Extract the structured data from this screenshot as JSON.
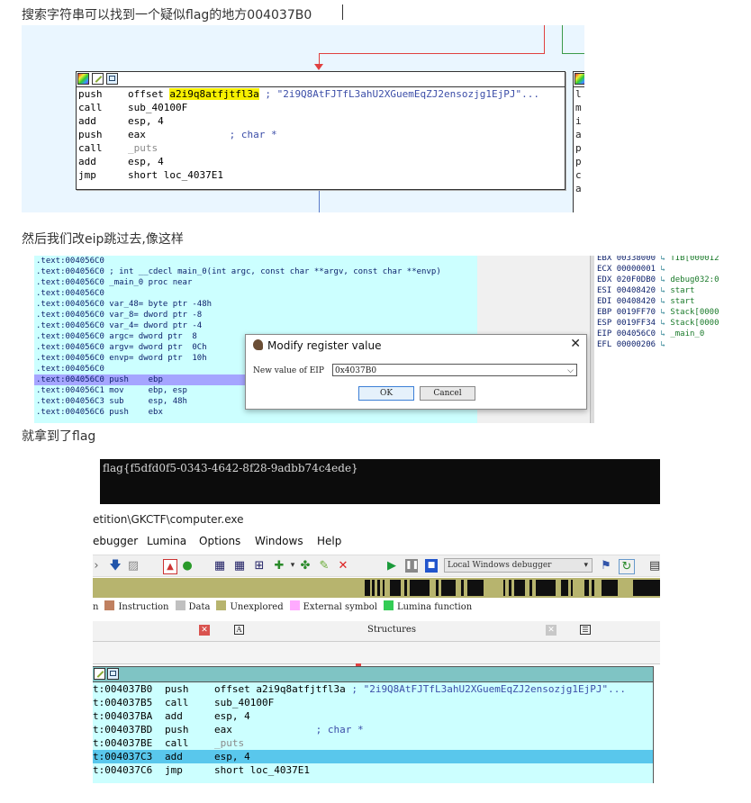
{
  "section1": {
    "heading": "搜索字符串可以找到一个疑似flag的地方004037B0",
    "node_icons": [
      "color-palette-icon",
      "pen-edit-icon",
      "graph-view-icon"
    ],
    "lines": [
      {
        "mnemonic": "push",
        "operand": "offset ",
        "highlight": "a2i9q8atfjtfl3a",
        "comment": " ; \"2i9Q8AtFJTfL3ahU2XGuemEqZJ2ensozjg1EjPJ\"..."
      },
      {
        "mnemonic": "call",
        "operand": "sub_40100F",
        "highlight": "",
        "comment": ""
      },
      {
        "mnemonic": "add",
        "operand": "esp, 4",
        "highlight": "",
        "comment": ""
      },
      {
        "mnemonic": "push",
        "operand": "eax",
        "highlight": "",
        "comment": "              ; char *"
      },
      {
        "mnemonic": "call",
        "operand": "_puts",
        "highlight": "",
        "comment": ""
      },
      {
        "mnemonic": "add",
        "operand": "esp, 4",
        "highlight": "",
        "comment": ""
      },
      {
        "mnemonic": "jmp",
        "operand": "short loc_4037E1",
        "highlight": "",
        "comment": ""
      }
    ],
    "right_node_chars": [
      "l",
      "m",
      "i",
      "a",
      "p",
      "p",
      "c",
      "a"
    ]
  },
  "section2": {
    "heading": "然后我们改eip跳过去,像这样",
    "code_lines": [
      ".text:004056C0",
      ".text:004056C0 ; int __cdecl main_0(int argc, const char **argv, const char **envp)",
      ".text:004056C0 _main_0 proc near",
      ".text:004056C0",
      ".text:004056C0 var_48= byte ptr -48h",
      ".text:004056C0 var_8= dword ptr -8",
      ".text:004056C0 var_4= dword ptr -4",
      ".text:004056C0 argc= dword ptr  8",
      ".text:004056C0 argv= dword ptr  0Ch",
      ".text:004056C0 envp= dword ptr  10h",
      ".text:004056C0",
      ".text:004056C0 push    ebp",
      ".text:004056C1 mov     ebp, esp",
      ".text:004056C3 sub     esp, 48h",
      ".text:004056C6 push    ebx"
    ],
    "selected_index": 11,
    "registers": [
      {
        "name": "EBX",
        "value": "00338000",
        "ref": "TIB[000012"
      },
      {
        "name": "ECX",
        "value": "00000001",
        "ref": ""
      },
      {
        "name": "EDX",
        "value": "020F0DB0",
        "ref": "debug032:0"
      },
      {
        "name": "ESI",
        "value": "00408420",
        "ref": "start"
      },
      {
        "name": "EDI",
        "value": "00408420",
        "ref": "start"
      },
      {
        "name": "EBP",
        "value": "0019FF70",
        "ref": "Stack[0000"
      },
      {
        "name": "ESP",
        "value": "0019FF34",
        "ref": "Stack[0000"
      },
      {
        "name": "EIP",
        "value": "004056C0",
        "ref": "_main_0"
      },
      {
        "name": "EFL",
        "value": "00000206",
        "ref": ""
      }
    ],
    "dialog": {
      "title": "Modify register value",
      "label": "New value of EIP",
      "value": "0x4037B0",
      "ok": "OK",
      "cancel": "Cancel"
    }
  },
  "section3": {
    "heading": "就拿到了flag",
    "console_text": "flag{f5dfd0f5-0343-4642-8f28-9adbb74c4ede}",
    "path": "etition\\GKCTF\\computer.exe",
    "menu": [
      "ebugger",
      "Lumina",
      "Options",
      "Windows",
      "Help"
    ],
    "debugger_select": "Local Windows debugger",
    "legend": [
      {
        "label": "n",
        "color": ""
      },
      {
        "label": "Instruction",
        "color": "#c08060"
      },
      {
        "label": "Data",
        "color": "#c0c0c0"
      },
      {
        "label": "Unexplored",
        "color": "#b7b46e"
      },
      {
        "label": "External symbol",
        "color": "#ffaaff"
      },
      {
        "label": "Lumina function",
        "color": "#33cc55"
      }
    ],
    "tab_structures": "Structures",
    "lines": [
      {
        "addr": "t:004037B0",
        "mnemonic": "push",
        "operand": "offset a2i9q8atfjtfl3a",
        "comment": " ; \"2i9Q8AtFJTfL3ahU2XGuemEqZJ2ensozjg1EjPJ\"..."
      },
      {
        "addr": "t:004037B5",
        "mnemonic": "call",
        "operand": "sub_40100F",
        "comment": ""
      },
      {
        "addr": "t:004037BA",
        "mnemonic": "add",
        "operand": "esp, 4",
        "comment": ""
      },
      {
        "addr": "t:004037BD",
        "mnemonic": "push",
        "operand": "eax",
        "comment": "              ; char *"
      },
      {
        "addr": "t:004037BE",
        "mnemonic": "call",
        "operand": "_puts",
        "comment": ""
      },
      {
        "addr": "t:004037C3",
        "mnemonic": "add",
        "operand": "esp, 4",
        "comment": ""
      },
      {
        "addr": "t:004037C6",
        "mnemonic": "jmp",
        "operand": "short loc_4037E1",
        "comment": ""
      }
    ],
    "selected_index": 5
  }
}
